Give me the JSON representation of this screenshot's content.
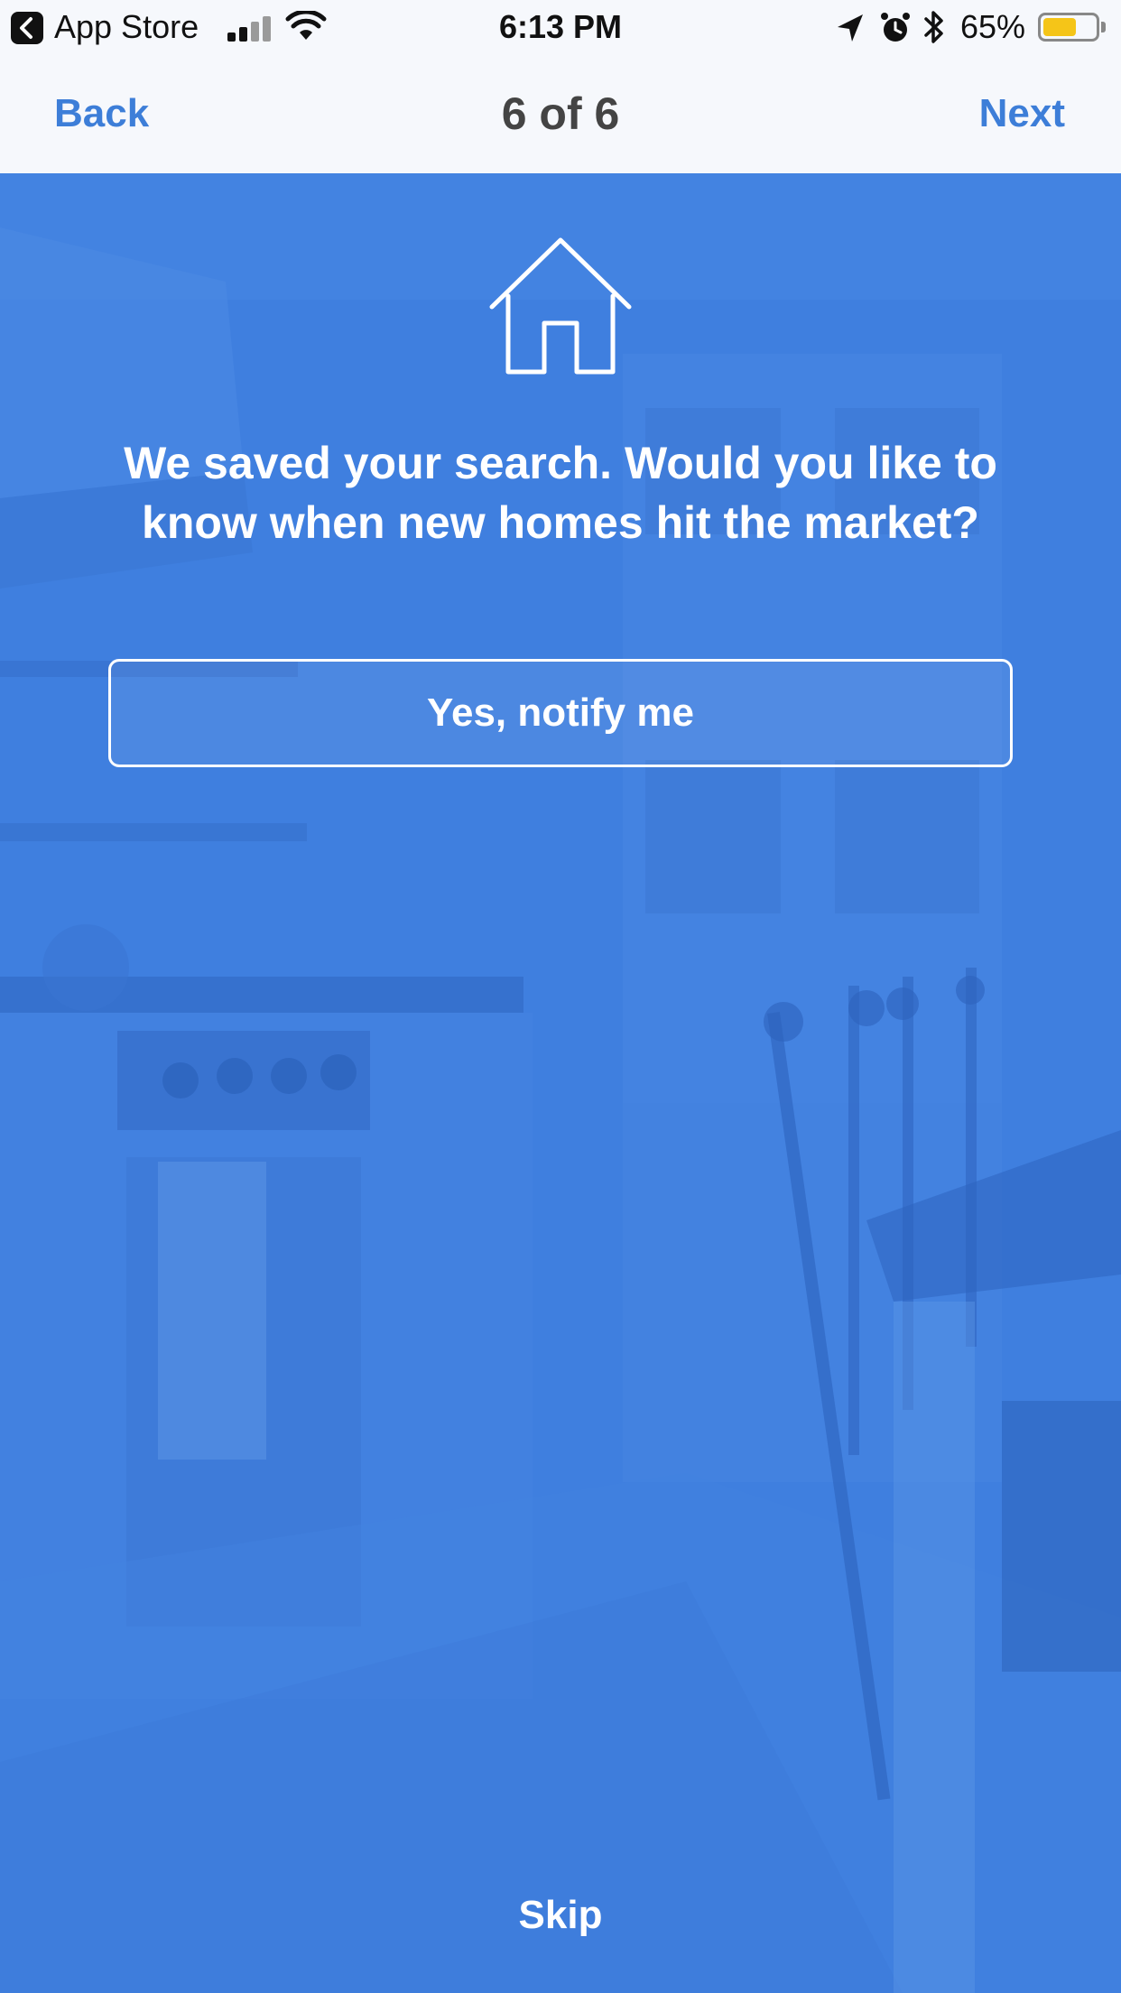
{
  "status_bar": {
    "back_app": "App Store",
    "time": "6:13 PM",
    "battery_percent": "65%",
    "battery_level": 0.65,
    "battery_color": "#f5c518",
    "icons": [
      "back-arrow-icon",
      "signal-icon",
      "wifi-icon",
      "location-icon",
      "alarm-icon",
      "bluetooth-icon",
      "battery-icon"
    ]
  },
  "nav": {
    "back_label": "Back",
    "title": "6 of 6",
    "next_label": "Next",
    "accent_color": "#3d7ed8"
  },
  "main": {
    "icon": "house-icon",
    "headline": "We saved your search. Would you like to know when new homes hit the market?",
    "notify_button_label": "Yes, notify me",
    "skip_label": "Skip",
    "background_color": "#3f7fdf"
  }
}
